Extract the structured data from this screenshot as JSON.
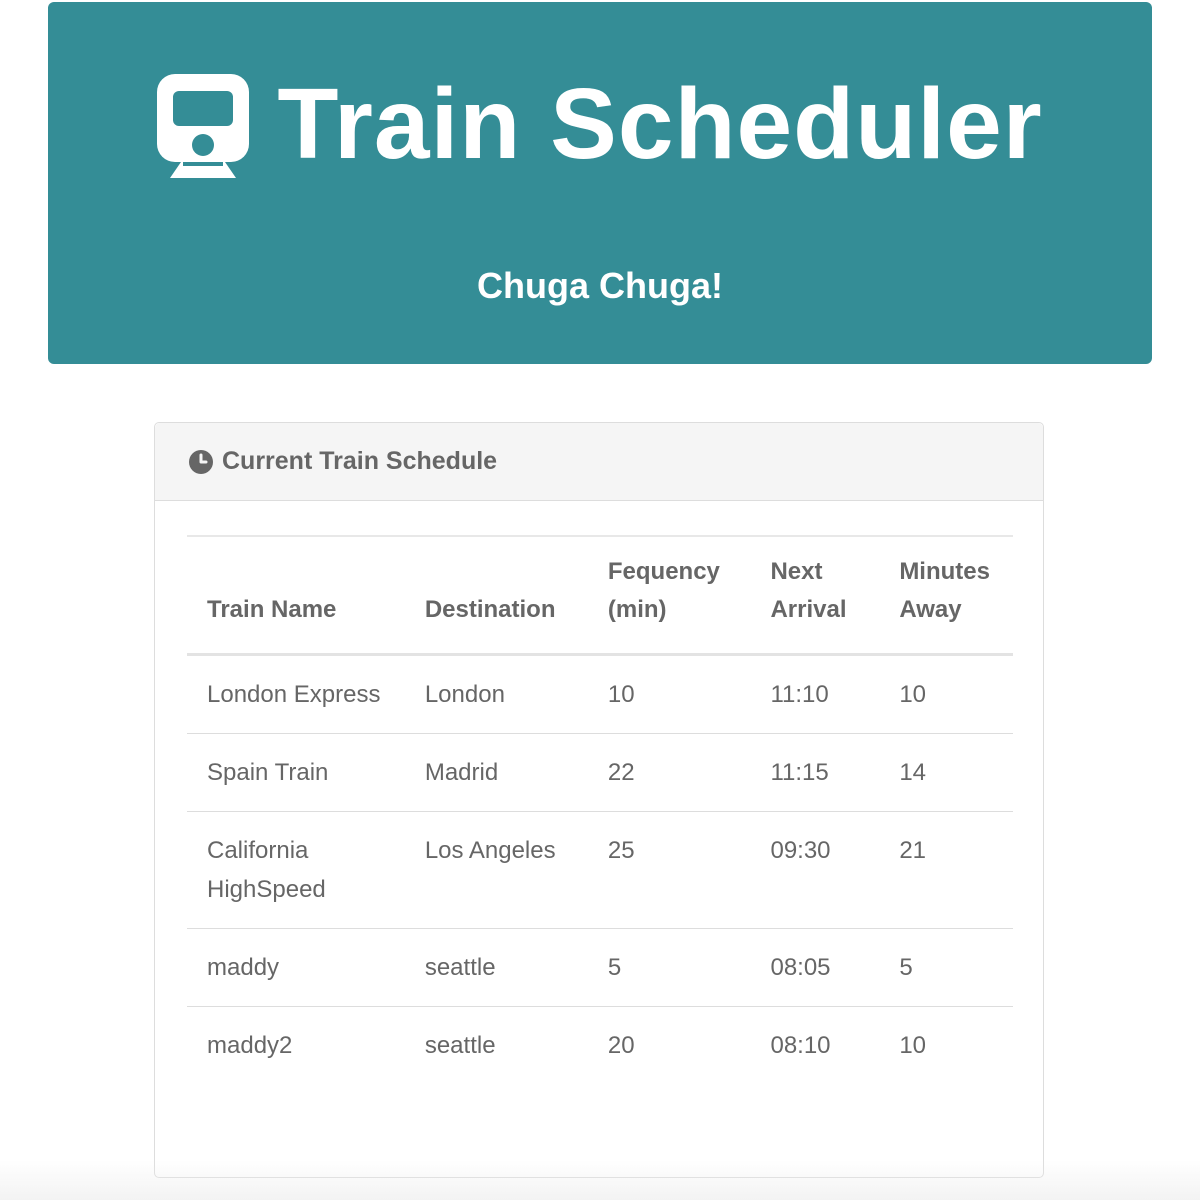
{
  "header": {
    "title": "Train Scheduler",
    "subtitle": "Chuga Chuga!",
    "icon": "train-icon",
    "background_color": "#348d96"
  },
  "panel": {
    "title": "Current Train Schedule",
    "icon": "clock-icon"
  },
  "table": {
    "headers": [
      "Train Name",
      "Destination",
      "Fequency (min)",
      "Next Arrival",
      "Minutes Away"
    ],
    "rows": [
      [
        "London Express",
        "London",
        "10",
        "11:10",
        "10"
      ],
      [
        "Spain Train",
        "Madrid",
        "22",
        "11:15",
        "14"
      ],
      [
        "California HighSpeed",
        "Los Angeles",
        "25",
        "09:30",
        "21"
      ],
      [
        "maddy",
        "seattle",
        "5",
        "08:05",
        "5"
      ],
      [
        "maddy2",
        "seattle",
        "20",
        "08:10",
        "10"
      ]
    ]
  }
}
